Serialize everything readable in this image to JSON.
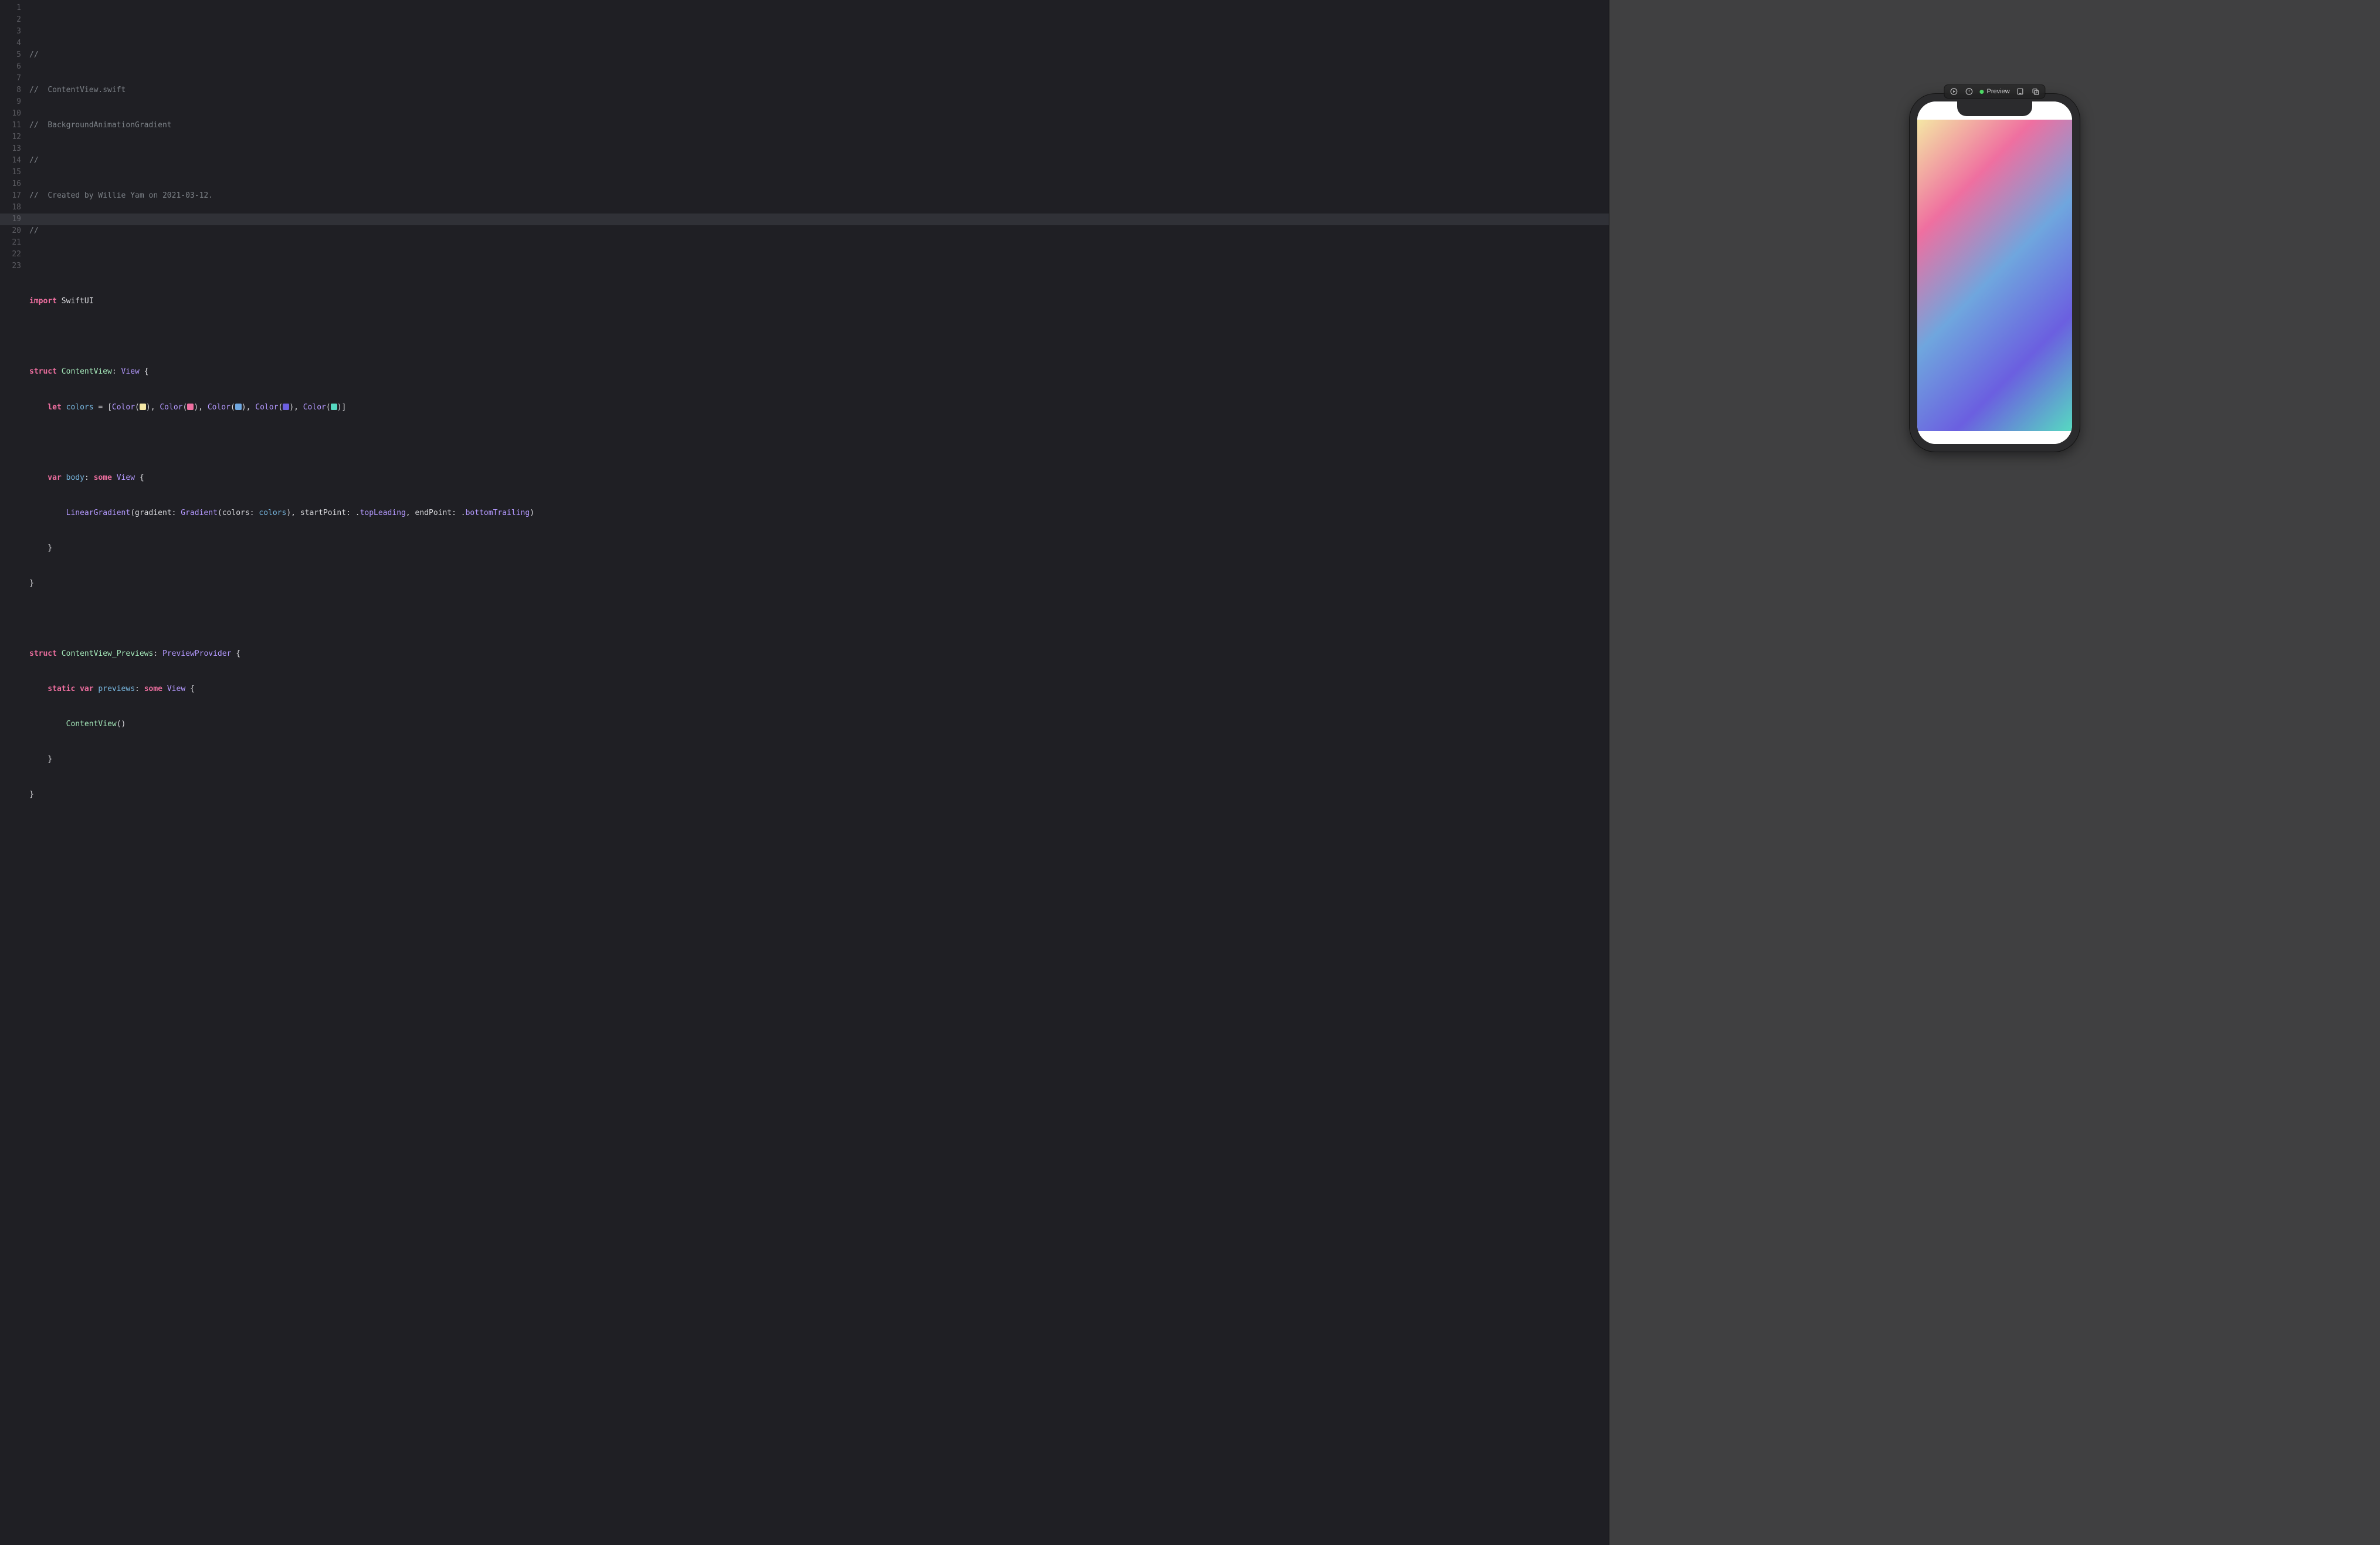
{
  "editor": {
    "highlighted_line": 19,
    "total_lines": 23,
    "gradient_swatches": [
      "#f4e7a4",
      "#ef6fa0",
      "#6fa6de",
      "#6b5fe0",
      "#56d9c1"
    ],
    "lines": {
      "l1": "//",
      "l2a": "//  ",
      "l2b": "ContentView.swift",
      "l3a": "//  ",
      "l3b": "BackgroundAnimationGradient",
      "l4": "//",
      "l5a": "//  ",
      "l5b": "Created by Willie Yam on 2021-03-12.",
      "l6": "//",
      "l7": "",
      "l8_import": "import",
      "l8_mod": " SwiftUI",
      "l9": "",
      "l10_struct": "struct",
      "l10_name": " ContentView",
      "l10_colon": ": ",
      "l10_proto": "View",
      "l10_brace": " {",
      "l11_let": "    let",
      "l11_name": " colors",
      "l11_eq": " = [",
      "l11_color": "Color",
      "l11_p": "(",
      "l11_cp": ")",
      "l11_comma": ", ",
      "l11_close": "]",
      "l12": "",
      "l13_var": "    var",
      "l13_body": " body",
      "l13_colon": ": ",
      "l13_some": "some",
      "l13_view": " View",
      "l13_brace": " {",
      "l14_indent": "        ",
      "l14_lg": "LinearGradient",
      "l14_p1": "(gradient: ",
      "l14_grad": "Gradient",
      "l14_p2": "(colors: ",
      "l14_colors": "colors",
      "l14_p3": "), startPoint: .",
      "l14_tl": "topLeading",
      "l14_p4": ", endPoint: .",
      "l14_bt": "bottomTrailing",
      "l14_p5": ")",
      "l15": "    }",
      "l16": "}",
      "l17": "",
      "l18_struct": "struct",
      "l18_name": " ContentView_Previews",
      "l18_colon": ": ",
      "l18_proto": "PreviewProvider",
      "l18_brace": " {",
      "l19_static": "    static",
      "l19_var": " var",
      "l19_prev": " previews",
      "l19_colon": ": ",
      "l19_some": "some",
      "l19_view": " View",
      "l19_brace": " {",
      "l20_indent": "        ",
      "l20_call": "ContentView",
      "l20_paren": "()",
      "l21": "    }",
      "l22": "}",
      "l23": ""
    }
  },
  "preview": {
    "status_label": "Preview",
    "gradient_colors": [
      "#f4e7a4",
      "#ef6fa0",
      "#6fa6de",
      "#6b5fe0",
      "#56d9c1"
    ]
  }
}
